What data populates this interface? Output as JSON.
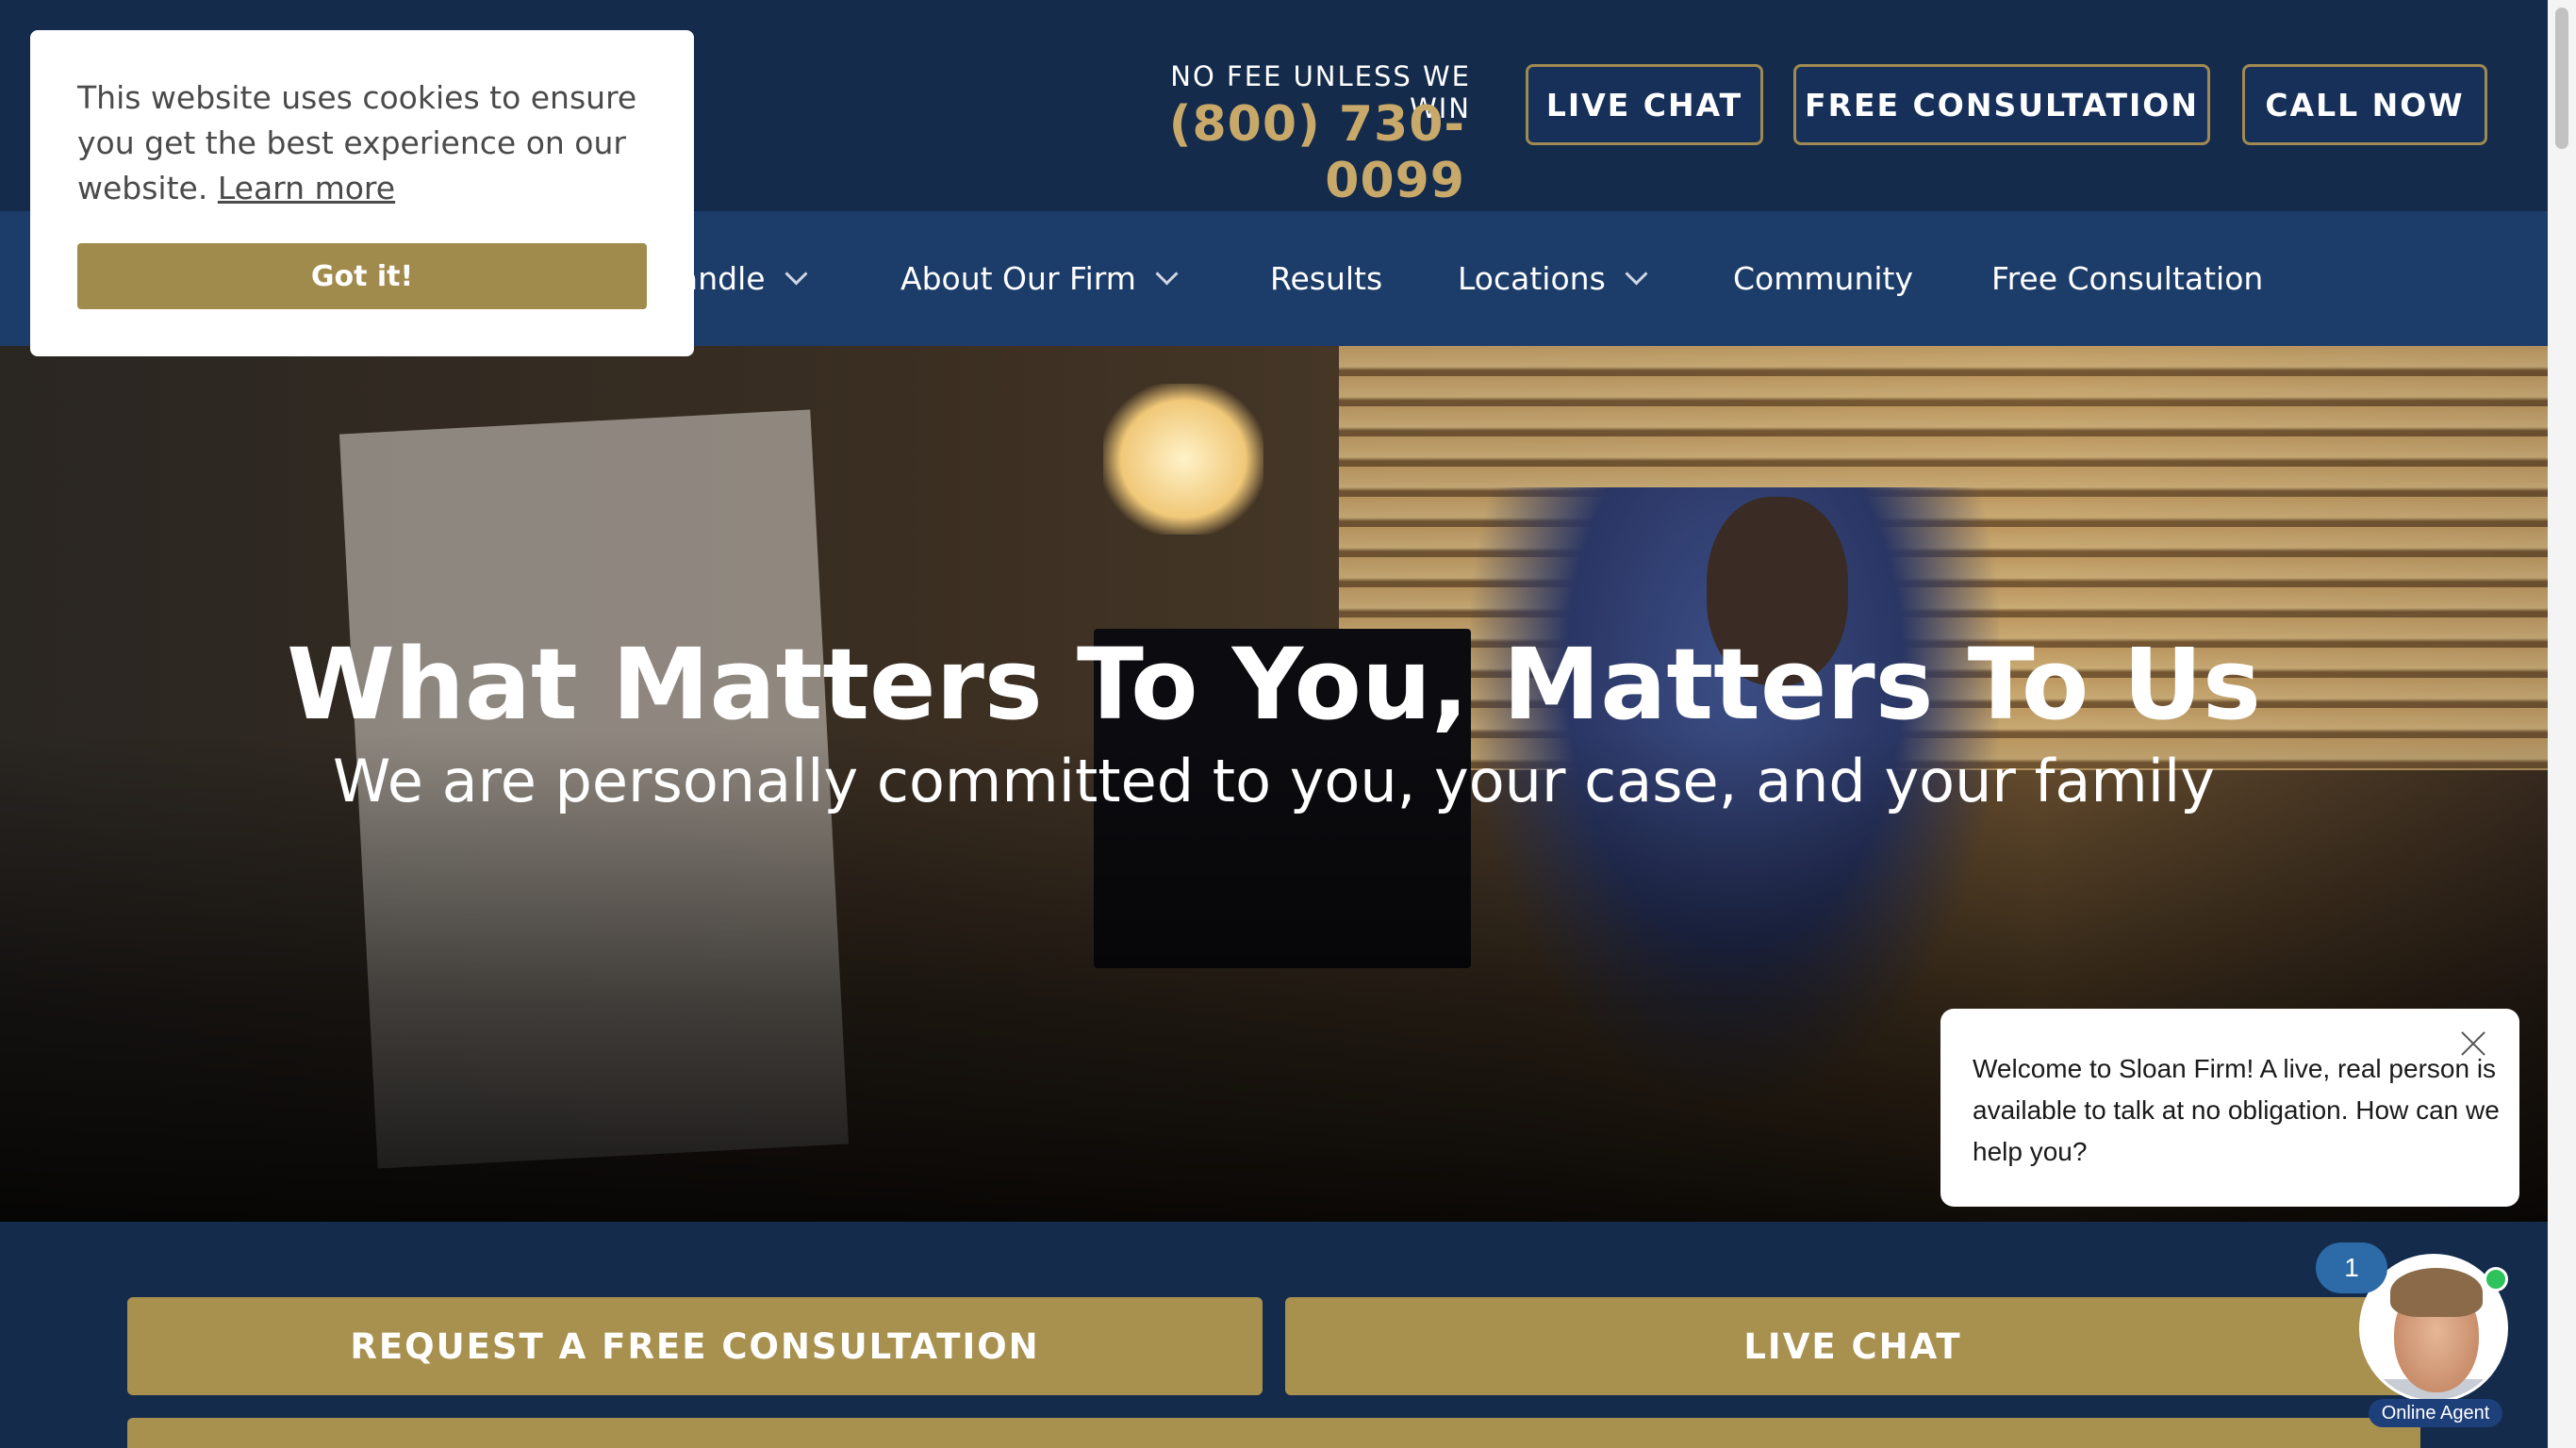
{
  "header": {
    "tagline": "NO FEE UNLESS WE WIN",
    "phone": "(800) 730-0099",
    "buttons": {
      "live_chat": "LIVE CHAT",
      "free_consultation": "FREE CONSULTATION",
      "call_now": "CALL NOW"
    }
  },
  "nav": {
    "items": [
      {
        "label": "andle",
        "dropdown": true
      },
      {
        "label": "About Our Firm",
        "dropdown": true
      },
      {
        "label": "Results",
        "dropdown": false
      },
      {
        "label": "Locations",
        "dropdown": true
      },
      {
        "label": "Community",
        "dropdown": false
      },
      {
        "label": "Free Consultation",
        "dropdown": false
      }
    ]
  },
  "hero": {
    "title": "What Matters To You, Matters To Us",
    "subtitle": "We are personally committed to you, your case, and your family"
  },
  "cta": {
    "request": "REQUEST A FREE CONSULTATION",
    "live_chat": "LIVE CHAT"
  },
  "cookie": {
    "text": "This website uses cookies to ensure you get the best experience on our website.",
    "learn_more": "Learn more",
    "button": "Got it!"
  },
  "chat": {
    "message": "Welcome to Sloan Firm! A live, real person is available to talk at no obligation. How can we help you?",
    "unread_count": "1",
    "status": "Online Agent"
  },
  "colors": {
    "navy": "#142b4c",
    "nav_blue": "#1c3c6a",
    "gold": "#a8914f",
    "phone_gold": "#c8a96a"
  }
}
